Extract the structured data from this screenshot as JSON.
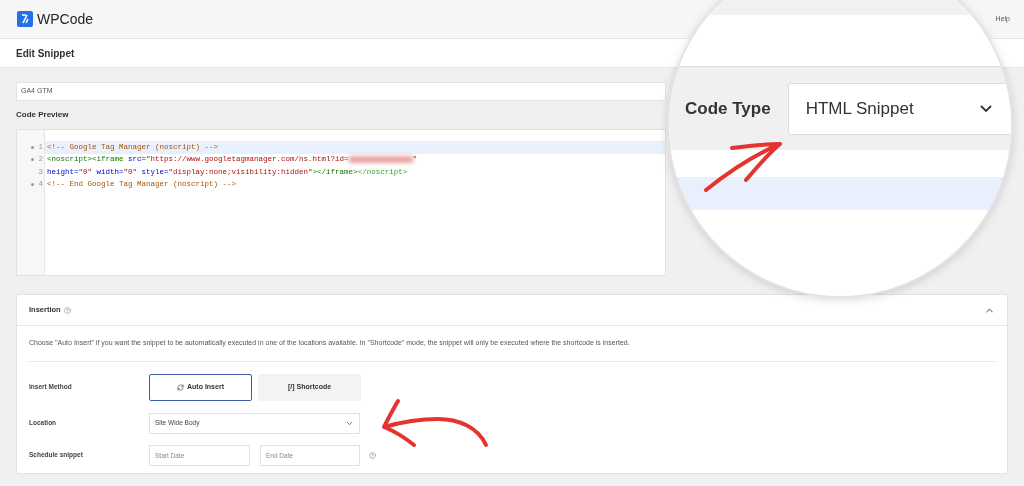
{
  "header": {
    "brand": "WPCode",
    "help": "Help"
  },
  "page_title": "Edit Snippet",
  "snippet_title": {
    "value": "GA4 GTM"
  },
  "code_preview": {
    "label": "Code Preview",
    "lines": [
      {
        "number": "1",
        "foldable": true,
        "highlighted": true,
        "tokens": [
          {
            "kind": "comment",
            "text": "<!-- Google Tag Manager (noscript) -->"
          }
        ]
      },
      {
        "number": "2",
        "foldable": true,
        "highlighted": false,
        "tokens": [
          {
            "kind": "tag",
            "text": "<noscript><iframe"
          },
          {
            "kind": "attr",
            "text": " src="
          },
          {
            "kind": "string",
            "text": "\"https://www.googletagmanager.com/ns.html?id="
          },
          {
            "kind": "redacted"
          },
          {
            "kind": "string",
            "text": "\""
          }
        ]
      },
      {
        "number": "3",
        "foldable": false,
        "highlighted": false,
        "tokens": [
          {
            "kind": "attr",
            "text": "height="
          },
          {
            "kind": "string",
            "text": "\"0\""
          },
          {
            "kind": "attr",
            "text": " width="
          },
          {
            "kind": "string",
            "text": "\"0\""
          },
          {
            "kind": "attr",
            "text": " style="
          },
          {
            "kind": "string",
            "text": "\"display:none;visibility:hidden\""
          },
          {
            "kind": "tag",
            "text": "></iframe>"
          },
          {
            "kind": "closing",
            "text": "</noscript>"
          }
        ]
      },
      {
        "number": "4",
        "foldable": true,
        "highlighted": false,
        "tokens": [
          {
            "kind": "comment",
            "text": "<!-- End Google Tag Manager (noscript) -->"
          }
        ]
      }
    ]
  },
  "magnifier": {
    "label": "Code Type",
    "select": {
      "value": "HTML Snippet"
    }
  },
  "insertion": {
    "title": "Insertion",
    "expanded": true,
    "description": "Choose \"Auto Insert\" if you want the snippet to be automatically executed in one of the locations available. In \"Shortcode\" mode, the snippet will only be executed where the shortcode is inserted.",
    "insert_method": {
      "label": "Insert Method",
      "options": [
        {
          "kind": "auto",
          "label": "Auto Insert",
          "selected": true
        },
        {
          "kind": "shortcode",
          "label": "[/] Shortcode",
          "selected": false
        }
      ]
    },
    "location": {
      "label": "Location",
      "value": "Site Wide Body"
    },
    "schedule": {
      "label": "Schedule snippet",
      "start_placeholder": "Start Date",
      "end_placeholder": "End Date"
    }
  }
}
